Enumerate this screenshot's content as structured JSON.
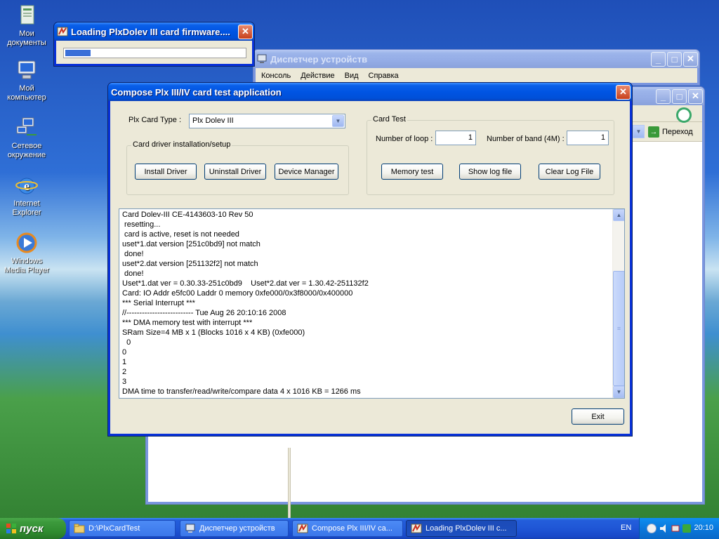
{
  "desktop": {
    "icons": [
      {
        "label": "Мои документы"
      },
      {
        "label": "Мой компьютер"
      },
      {
        "label": "Сетевое окружение"
      },
      {
        "label": "Internet Explorer"
      },
      {
        "label": "Windows Media Player"
      }
    ]
  },
  "loading_window": {
    "title": "Loading PlxDolev III card firmware....",
    "progress": 0.14
  },
  "device_manager": {
    "title": "Диспетчер устройств",
    "menu": [
      "Консоль",
      "Действие",
      "Вид",
      "Справка"
    ]
  },
  "back_window": {
    "go_label": "Переход"
  },
  "main_window": {
    "title": "Compose Plx III/IV card test application",
    "card_type_label": "Plx Card Type :",
    "card_type_value": "Plx Dolev III",
    "driver_group_label": "Card driver installation/setup",
    "install_label": "Install Driver",
    "uninstall_label": "Uninstall Driver",
    "device_manager_label": "Device Manager",
    "card_test_group_label": "Card Test",
    "loops_label": "Number of loop :",
    "loops_value": "1",
    "band_label": "Number of band (4M) :",
    "band_value": "1",
    "memory_test_label": "Memory test",
    "show_log_label": "Show log file",
    "clear_log_label": "Clear Log File",
    "exit_label": "Exit",
    "log_lines": [
      "Card Dolev-III CE-4143603-10 Rev 50",
      " resetting...",
      " card is active, reset is not needed",
      "uset*1.dat version [251c0bd9] not match",
      " done!",
      "uset*2.dat version [251132f2] not match",
      " done!",
      "Uset*1.dat ver = 0.30.33-251c0bd9    Uset*2.dat ver = 1.30.42-251132f2",
      "Card: IO Addr e5fc00 Laddr 0 memory 0xfe000/0x3f8000/0x400000",
      "*** Serial Interrupt ***",
      "//-------------------------- Tue Aug 26 20:10:16 2008",
      "*** DMA memory test with interrupt ***",
      "SRam Size=4 MB x 1 (Blocks 1016 x 4 KB) (0xfe000)",
      "  0",
      "0",
      "1",
      "2",
      "3",
      "DMA time to transfer/read/write/compare data 4 x 1016 KB = 1266 ms"
    ]
  },
  "taskbar": {
    "start_label": "пуск",
    "items": [
      {
        "label": "D:\\PlxCardTest"
      },
      {
        "label": "Диспетчер устройств"
      },
      {
        "label": "Compose Plx III/IV ca..."
      },
      {
        "label": "Loading PlxDolev III c..."
      }
    ],
    "language": "EN",
    "clock": "20:10"
  },
  "colors": {
    "xp_blue": "#0054e3",
    "window_face": "#ece9d8",
    "progress_fill": "#3a6fd8"
  }
}
